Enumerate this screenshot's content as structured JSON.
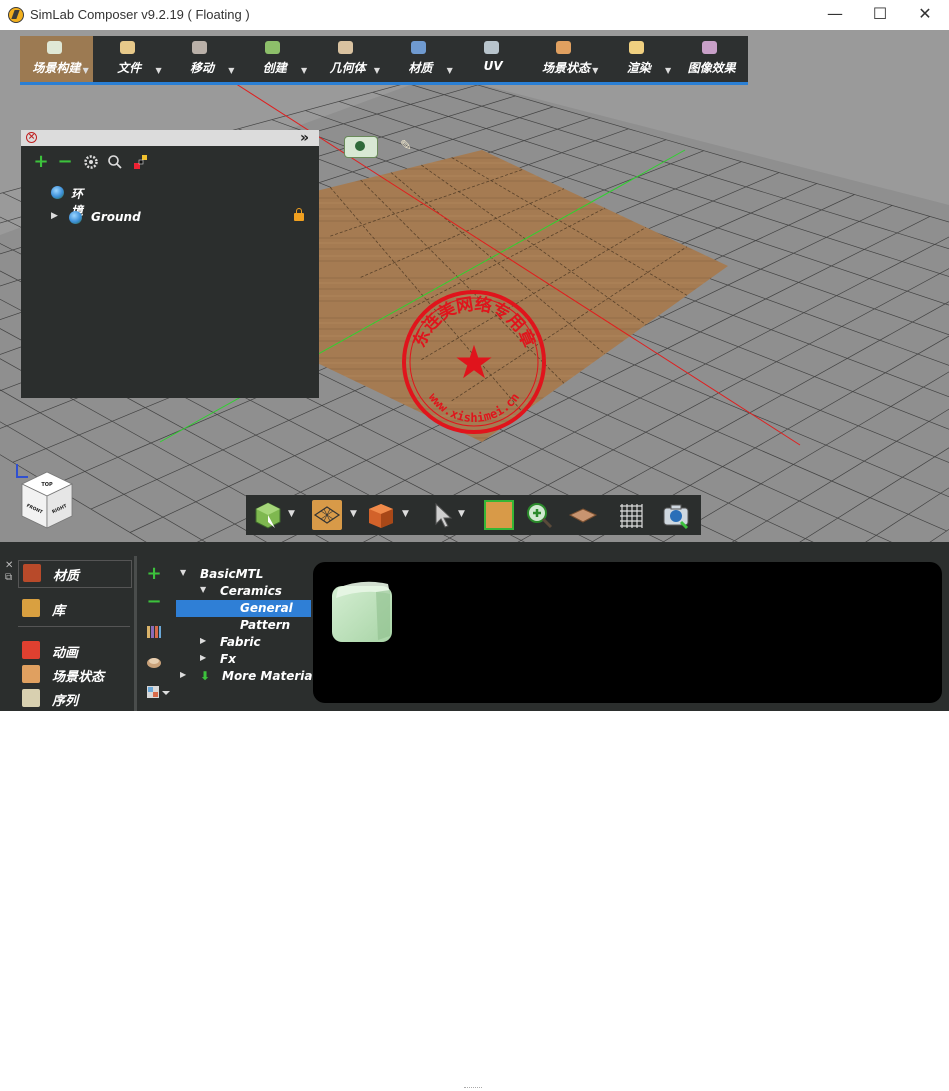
{
  "window": {
    "title": "SimLab Composer v9.2.19 ( Floating )",
    "minimize": "—",
    "maximize": "☐",
    "close": "✕"
  },
  "main_toolbar": {
    "items": [
      {
        "label": "场景构建",
        "icon": "scene-build-icon",
        "active": true,
        "color": "#dfe8d6"
      },
      {
        "label": "文件",
        "icon": "file-icon",
        "color": "#e7c98a"
      },
      {
        "label": "移动",
        "icon": "move-icon",
        "color": "#b9b0a8"
      },
      {
        "label": "创建",
        "icon": "create-icon",
        "color": "#8dbf6a"
      },
      {
        "label": "几何体",
        "icon": "geometry-icon",
        "color": "#d9c2a0"
      },
      {
        "label": "材质",
        "icon": "material-icon",
        "color": "#6f9ad0"
      },
      {
        "label": "UV",
        "icon": "uv-icon",
        "color": "#b8c4cc"
      },
      {
        "label": "场景状态",
        "icon": "scene-state-icon",
        "color": "#e0a060"
      },
      {
        "label": "渲染",
        "icon": "render-icon",
        "color": "#f0d080"
      },
      {
        "label": "图像效果",
        "icon": "image-effects-icon",
        "color": "#c8a0c8"
      }
    ]
  },
  "scene_panel": {
    "add": "+",
    "remove": "−",
    "items": [
      {
        "label": "环境",
        "icon": "environment-globe-icon"
      },
      {
        "label": "Ground",
        "icon": "ground-globe-icon",
        "expander": "▶"
      }
    ]
  },
  "watermark": {
    "text_top": "东连美网络专用章",
    "text_bottom": "www.xishimei.cn",
    "star": "★"
  },
  "viewcube": {
    "top": "TOP",
    "front": "FRONT",
    "right": "RIGHT"
  },
  "bottom_dock": {
    "tabs": [
      {
        "label": "材质",
        "icon": "material-tab-icon"
      },
      {
        "label": "库",
        "icon": "library-icon"
      },
      {
        "label": "动画",
        "icon": "animation-icon"
      },
      {
        "label": "场景状态",
        "icon": "scene-state-tab-icon"
      },
      {
        "label": "序列",
        "icon": "sequence-icon"
      }
    ],
    "side_add": "+",
    "side_remove": "−",
    "material_tree": [
      {
        "label": "BasicMTL",
        "level": 0,
        "expander": "▼"
      },
      {
        "label": "Ceramics",
        "level": 1,
        "expander": "▼"
      },
      {
        "label": "General",
        "level": 2,
        "selected": true
      },
      {
        "label": "Pattern",
        "level": 2
      },
      {
        "label": "Fabric",
        "level": 1,
        "expander": "▶"
      },
      {
        "label": "Fx",
        "level": 1,
        "expander": "▶"
      },
      {
        "label": "More Materials",
        "level": 0,
        "expander": "▶"
      }
    ]
  },
  "colors": {
    "panel_bg": "#2b2e2d",
    "accent": "#2f7fd6",
    "add_green": "#3cc23c",
    "stamp_red": "#e0141c",
    "viewport_grey": "#9a9a9a"
  }
}
